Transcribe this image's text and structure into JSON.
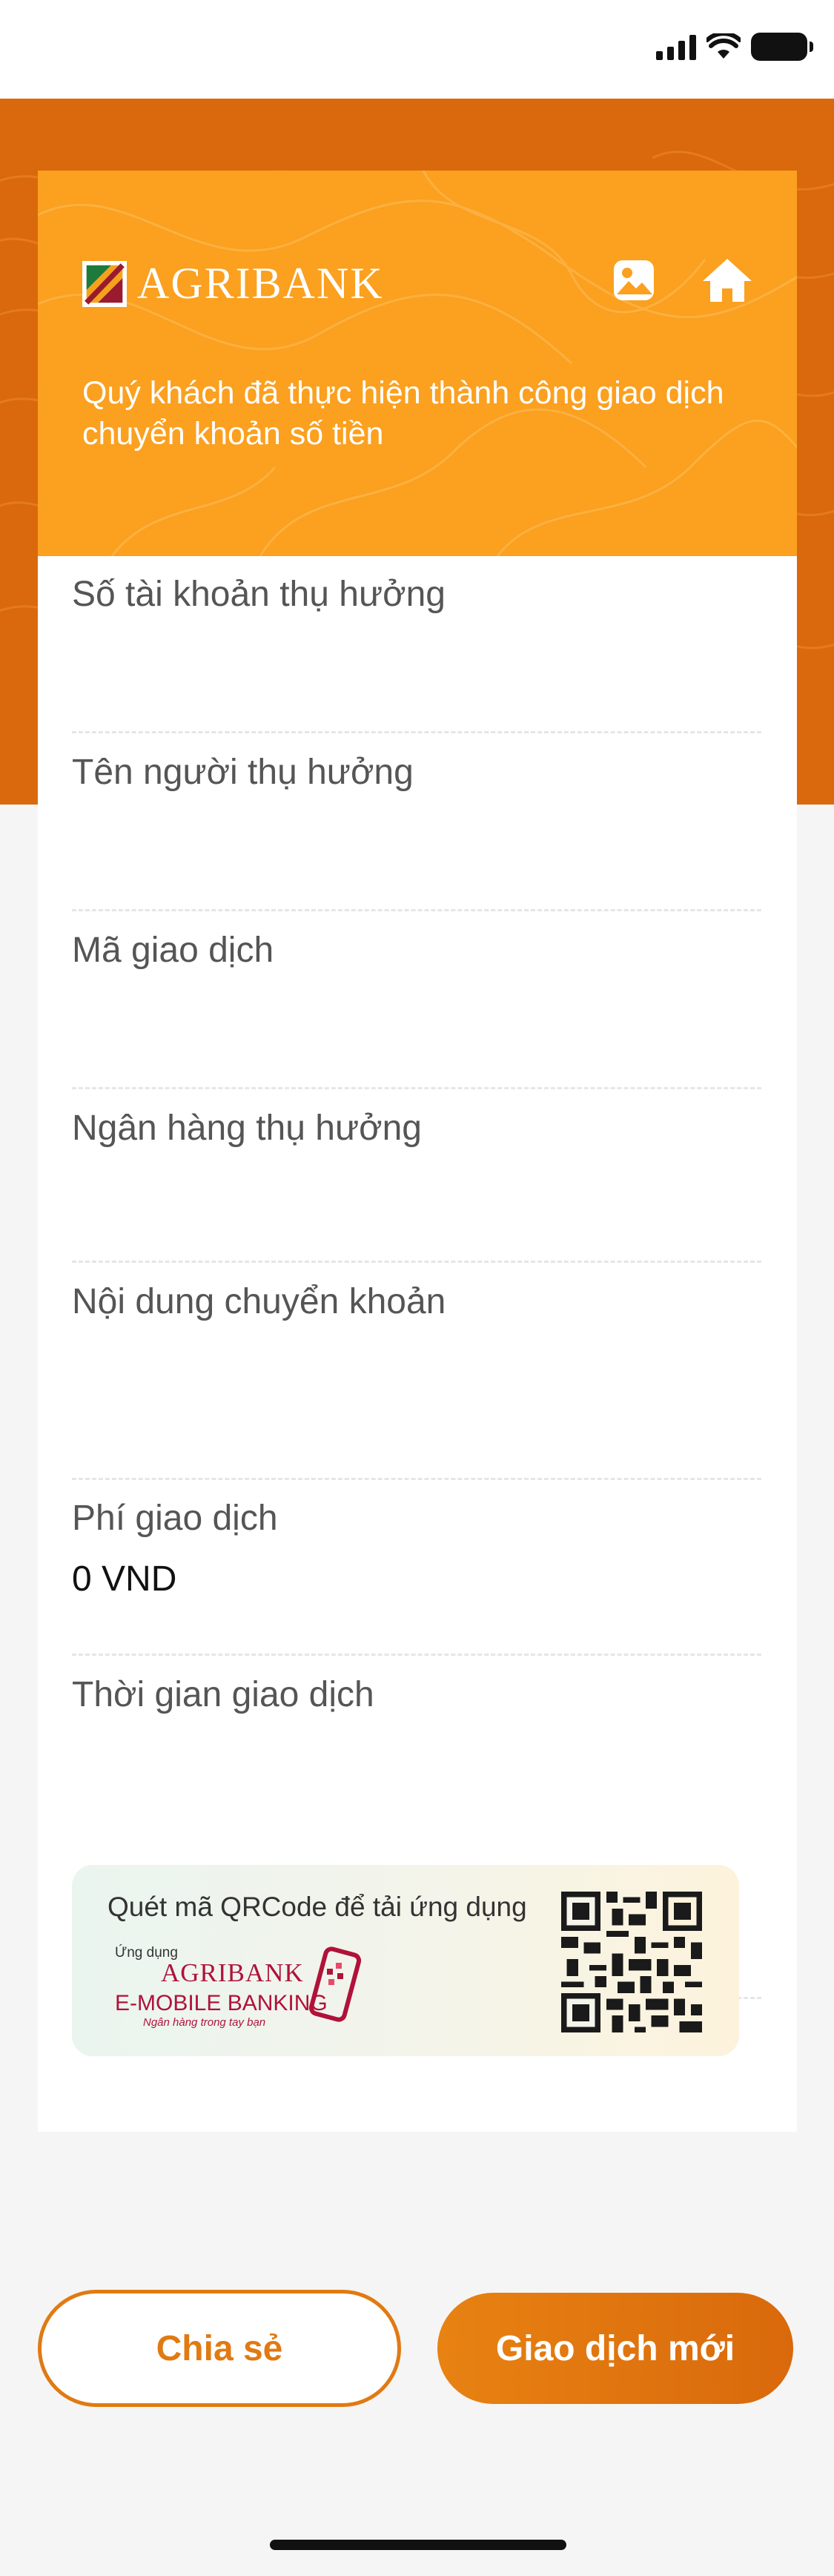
{
  "brand": {
    "name": "AGRIBANK"
  },
  "colors": {
    "primary": "#d9690c",
    "card_header": "#fba01f",
    "accent": "#e07a12"
  },
  "icons": {
    "gallery": "image-icon",
    "home": "home-icon"
  },
  "hero": {
    "message": "Quý khách đã thực hiện thành công giao dịch chuyển khoản số tiền"
  },
  "details": [
    {
      "label": "Số tài khoản thụ hưởng",
      "value": ""
    },
    {
      "label": "Tên người thụ hưởng",
      "value": ""
    },
    {
      "label": "Mã giao dịch",
      "value": ""
    },
    {
      "label": "Ngân hàng thụ hưởng",
      "value": ""
    },
    {
      "label": "Nội dung chuyển khoản",
      "value": ""
    },
    {
      "label": "Phí giao dịch",
      "value": "0 VND"
    },
    {
      "label": "Thời gian giao dịch",
      "value": ""
    }
  ],
  "promo": {
    "scan_text": "Quét mã QRCode để tải ứng dụng",
    "prefix": "Ứng dụng",
    "app_name": "AGRIBANK",
    "app_line": "E-MOBILE BANKING",
    "slogan": "Ngân hàng trong tay bạn"
  },
  "actions": {
    "share": "Chia sẻ",
    "new_transaction": "Giao dịch mới"
  }
}
